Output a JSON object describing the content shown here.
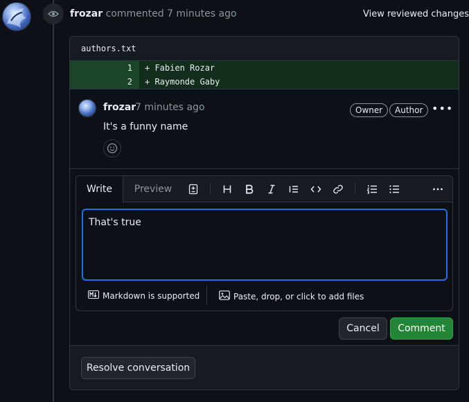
{
  "timeline_header": {
    "author": "frozar",
    "action": "commented",
    "time": "7 minutes ago",
    "view_reviewed_label": "View reviewed changes"
  },
  "file": {
    "name": "authors.txt",
    "diff_lines": [
      {
        "number": "1",
        "code": "+ Fabien Rozar"
      },
      {
        "number": "2",
        "code": "+ Raymonde Gaby"
      }
    ]
  },
  "comment": {
    "author": "frozar",
    "time": "7 minutes ago",
    "labels": [
      "Owner",
      "Author"
    ],
    "body": "It's a funny name"
  },
  "reply": {
    "tabs": {
      "write": "Write",
      "preview": "Preview"
    },
    "textarea_value": "That's true",
    "markdown_note": "Markdown is supported",
    "attach_note": "Paste, drop, or click to add files",
    "cancel_label": "Cancel",
    "comment_label": "Comment"
  },
  "resolve_label": "Resolve conversation",
  "colors": {
    "background": "#0d1117",
    "border": "#30363d",
    "accent_green": "#238636",
    "focus_blue": "#1f6feb",
    "diff_add": "#122d1b"
  }
}
